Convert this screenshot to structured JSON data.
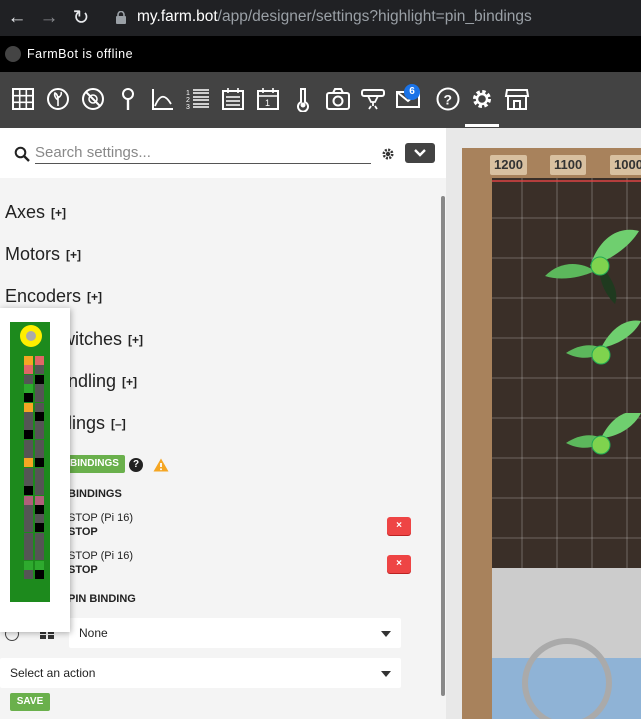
{
  "browser": {
    "url_host": "my.farm.bot",
    "url_path": "/app/designer/settings?highlight=pin_bindings"
  },
  "status": {
    "text": "FarmBot is offline"
  },
  "toolbar": {
    "icons": [
      "map-icon",
      "plants-icon",
      "weeds-icon",
      "points-icon",
      "curves-icon",
      "sequences-icon",
      "regimens-icon",
      "events-icon",
      "sensors-icon",
      "photos-icon",
      "tools-icon",
      "messages-icon",
      "help-icon",
      "settings-icon",
      "shop-icon"
    ],
    "message_count": "6",
    "active": "settings-icon"
  },
  "settings": {
    "search_placeholder": "Search settings...",
    "sections": [
      {
        "label": "Axes",
        "toggle": "[+]"
      },
      {
        "label": "Motors",
        "toggle": "[+]"
      },
      {
        "label": "Encoders",
        "toggle": "[+]"
      },
      {
        "label": "witches",
        "toggle": "[+]"
      },
      {
        "label": "ndling",
        "toggle": "[+]"
      },
      {
        "label": "lings",
        "toggle": "[–]"
      }
    ],
    "bindings_button": "BINDINGS",
    "help_symbol": "?",
    "existing_label": "BINDINGS",
    "bindings": [
      {
        "name": "STOP (Pi 16)",
        "action": "STOP",
        "delete": "×"
      },
      {
        "name": "STOP (Pi 16)",
        "action": "STOP",
        "delete": "×"
      }
    ],
    "add_label": "PIN BINDING",
    "pin_select": "None",
    "action_select": "Select an action",
    "save_label": "SAVE"
  },
  "map": {
    "ruler_labels": [
      "1200",
      "1100",
      "1000"
    ]
  },
  "colors": {
    "toolbar_bg": "#434343",
    "accent_green": "#6ab04c",
    "danger_red": "#e44444",
    "pi_green": "#1d8a1d"
  }
}
